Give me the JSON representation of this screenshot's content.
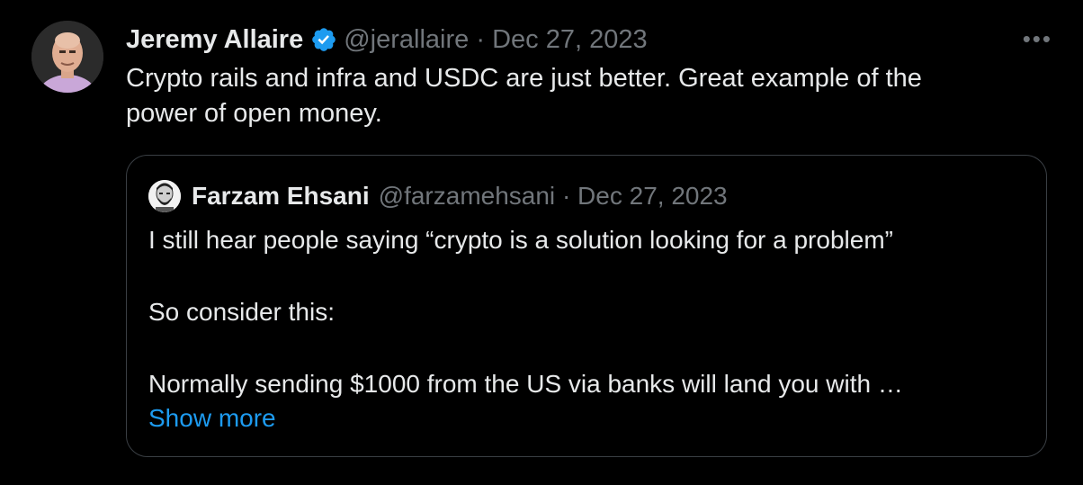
{
  "tweet": {
    "author_name": "Jeremy Allaire",
    "handle": "@jerallaire",
    "separator": "·",
    "date": "Dec 27, 2023",
    "text": "Crypto rails and infra and USDC are just better.  Great example of the\npower of open money.",
    "more_label": "•••"
  },
  "quote": {
    "author_name": "Farzam Ehsani",
    "handle": "@farzamehsani",
    "separator": "·",
    "date": "Dec 27, 2023",
    "text": "I still hear people saying “crypto is a solution looking for a problem”\n\nSo consider this:\n\nNormally sending $1000 from the US via banks will land you with …",
    "show_more_label": "Show more"
  },
  "colors": {
    "background": "#000000",
    "text": "#e7e9ea",
    "secondary_text": "#71767b",
    "link": "#1d9bf0",
    "verified_badge": "#1d9bf0",
    "quote_border": "#3a3f44"
  },
  "icons": {
    "verified": "verified-badge-icon",
    "more": "more-options-icon"
  }
}
